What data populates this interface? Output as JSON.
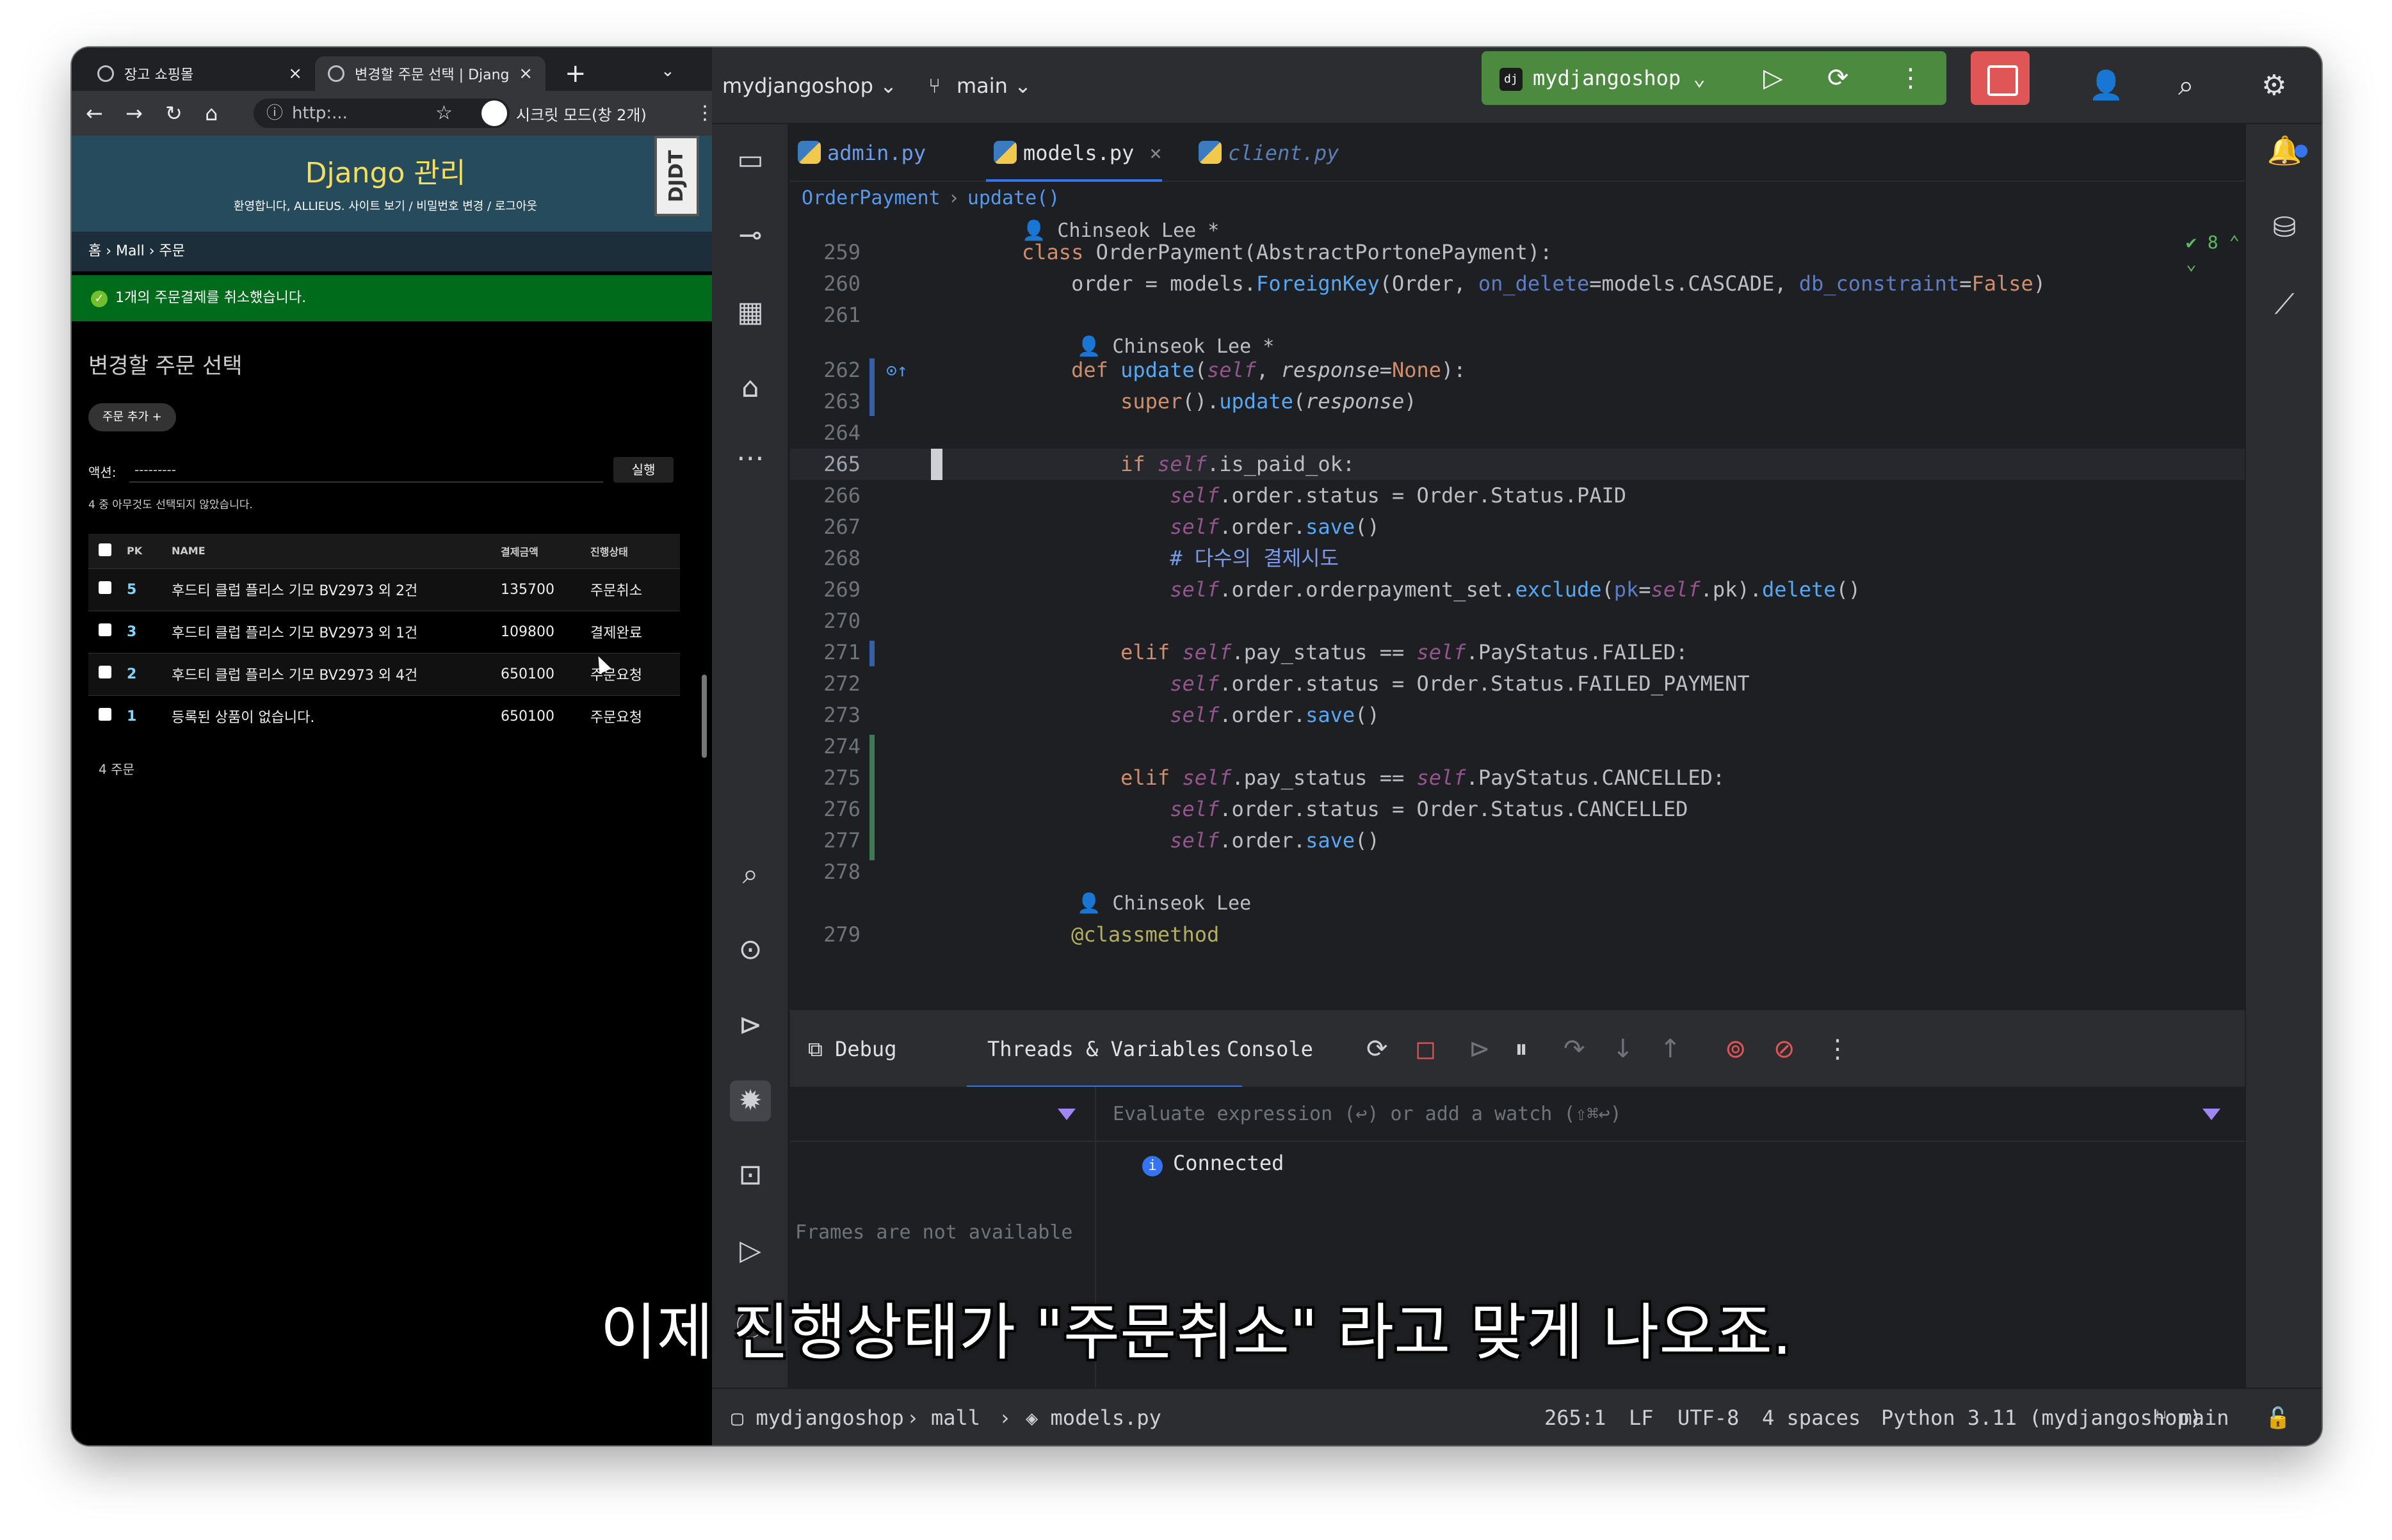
{
  "browser": {
    "tabs": [
      {
        "title": "장고 쇼핑몰",
        "close": "×"
      },
      {
        "title": "변경할 주문 선택 | Djang",
        "close": "×"
      }
    ],
    "new_tab": "+",
    "tab_menu": "⌄",
    "url": "http:...",
    "incognito": "시크릿 모드(창 2개)",
    "nav": {
      "back": "←",
      "forward": "→",
      "reload": "↻",
      "home": "⌂",
      "star": "☆",
      "menu": "⋮"
    }
  },
  "admin": {
    "site_title": "Django 관리",
    "user_tools": "환영합니다, ALLIEUS. 사이트 보기 / 비밀번호 변경 / 로그아웃",
    "djdt": "DJDT",
    "breadcrumbs": "홈 › Mall › 주문",
    "message": "1개의 주문결제를 취소했습니다.",
    "page_title": "변경할 주문 선택",
    "add_button": "주문 추가 +",
    "action_label": "액션:",
    "action_value": "---------",
    "run_button": "실행",
    "selection_count": "4 중 아무것도 선택되지 않았습니다.",
    "columns": [
      "PK",
      "NAME",
      "결제금액",
      "진행상태"
    ],
    "rows": [
      {
        "pk": "5",
        "name": "후드티 클럽 플리스 기모 BV2973 외 2건",
        "amount": "135700",
        "status": "주문취소"
      },
      {
        "pk": "3",
        "name": "후드티 클럽 플리스 기모 BV2973 외 1건",
        "amount": "109800",
        "status": "결제완료"
      },
      {
        "pk": "2",
        "name": "후드티 클럽 플리스 기모 BV2973 외 4건",
        "amount": "650100",
        "status": "주문요청"
      },
      {
        "pk": "1",
        "name": "등록된 상품이 없습니다.",
        "amount": "650100",
        "status": "주문요청"
      }
    ],
    "footer": "4 주문"
  },
  "ide": {
    "project": "mydjangoshop ⌄",
    "branch": "main ⌄",
    "run_config": "mydjangoshop ⌄",
    "run_config_badge": "dj",
    "tabs": [
      {
        "label": "admin.py"
      },
      {
        "label": "models.py",
        "close": "×"
      },
      {
        "label": "client.py"
      }
    ],
    "breadcrumb_class": "OrderPayment",
    "breadcrumb_sep": "›",
    "breadcrumb_method": "update()",
    "inspections": "✔ 8 ⌃ ⌄",
    "debug": {
      "tab_debug": "Debug",
      "tab_threads": "Threads & Variables",
      "tab_console": "Console",
      "eval_placeholder": "Evaluate expression (↩) or add a watch (⇧⌘↩)",
      "connected": "Connected",
      "no_frames": "Frames are not available"
    },
    "status": {
      "project": "mydjangoshop",
      "folder": "mall",
      "file": "models.py",
      "position": "265:1",
      "line_sep": "LF",
      "encoding": "UTF-8",
      "indent": "4 spaces",
      "interpreter": "Python 3.11 (mydjangoshop)",
      "branch": "main"
    }
  },
  "code": {
    "author1": "Chinseok Lee *",
    "author2": "Chinseok Lee *",
    "author3": "Chinseok Lee",
    "l259": [
      "class ",
      "OrderPayment",
      "(AbstractPortonePayment):"
    ],
    "l260": [
      "    order = models.",
      "ForeignKey",
      "(Order, ",
      "on_delete",
      "=models.CASCADE, ",
      "db_constraint",
      "=",
      "False",
      ")"
    ],
    "l262": [
      "    ",
      "def ",
      "update",
      "(",
      "self",
      ", ",
      "response",
      "=",
      "None",
      "):"
    ],
    "l263": [
      "        ",
      "super",
      "().",
      "update",
      "(",
      "response",
      ")"
    ],
    "l265": [
      "        ",
      "if ",
      "self",
      ".",
      "is_paid_ok",
      ":"
    ],
    "l266": [
      "            ",
      "self",
      ".order.status = Order.Status.PAID"
    ],
    "l267": [
      "            ",
      "self",
      ".order.",
      "save",
      "()"
    ],
    "l268": [
      "            # 다수의 결제시도"
    ],
    "l269": [
      "            ",
      "self",
      ".order.orderpayment_set.",
      "exclude",
      "(",
      "pk",
      "=",
      "self",
      ".pk).",
      "delete",
      "()"
    ],
    "l271": [
      "        ",
      "elif ",
      "self",
      ".pay_status == ",
      "self",
      ".PayStatus.FAILED:"
    ],
    "l272": [
      "            ",
      "self",
      ".order.status = Order.Status.FAILED_PAYMENT"
    ],
    "l273": [
      "            ",
      "self",
      ".order.",
      "save",
      "()"
    ],
    "l275": [
      "        ",
      "elif ",
      "self",
      ".pay_status == ",
      "self",
      ".PayStatus.CANCELLED:"
    ],
    "l276": [
      "            ",
      "self",
      ".order.status = Order.Status.CANCELLED"
    ],
    "l277": [
      "            ",
      "self",
      ".order.",
      "save",
      "()"
    ],
    "l279": [
      "    ",
      "@classmethod"
    ]
  },
  "line_numbers": [
    "259",
    "260",
    "261",
    "262",
    "263",
    "264",
    "265",
    "266",
    "267",
    "268",
    "269",
    "270",
    "271",
    "272",
    "273",
    "274",
    "275",
    "276",
    "277",
    "278",
    "279"
  ],
  "subtitle": "이제 진행상태가 \"주문취소\" 라고 맞게 나오죠."
}
